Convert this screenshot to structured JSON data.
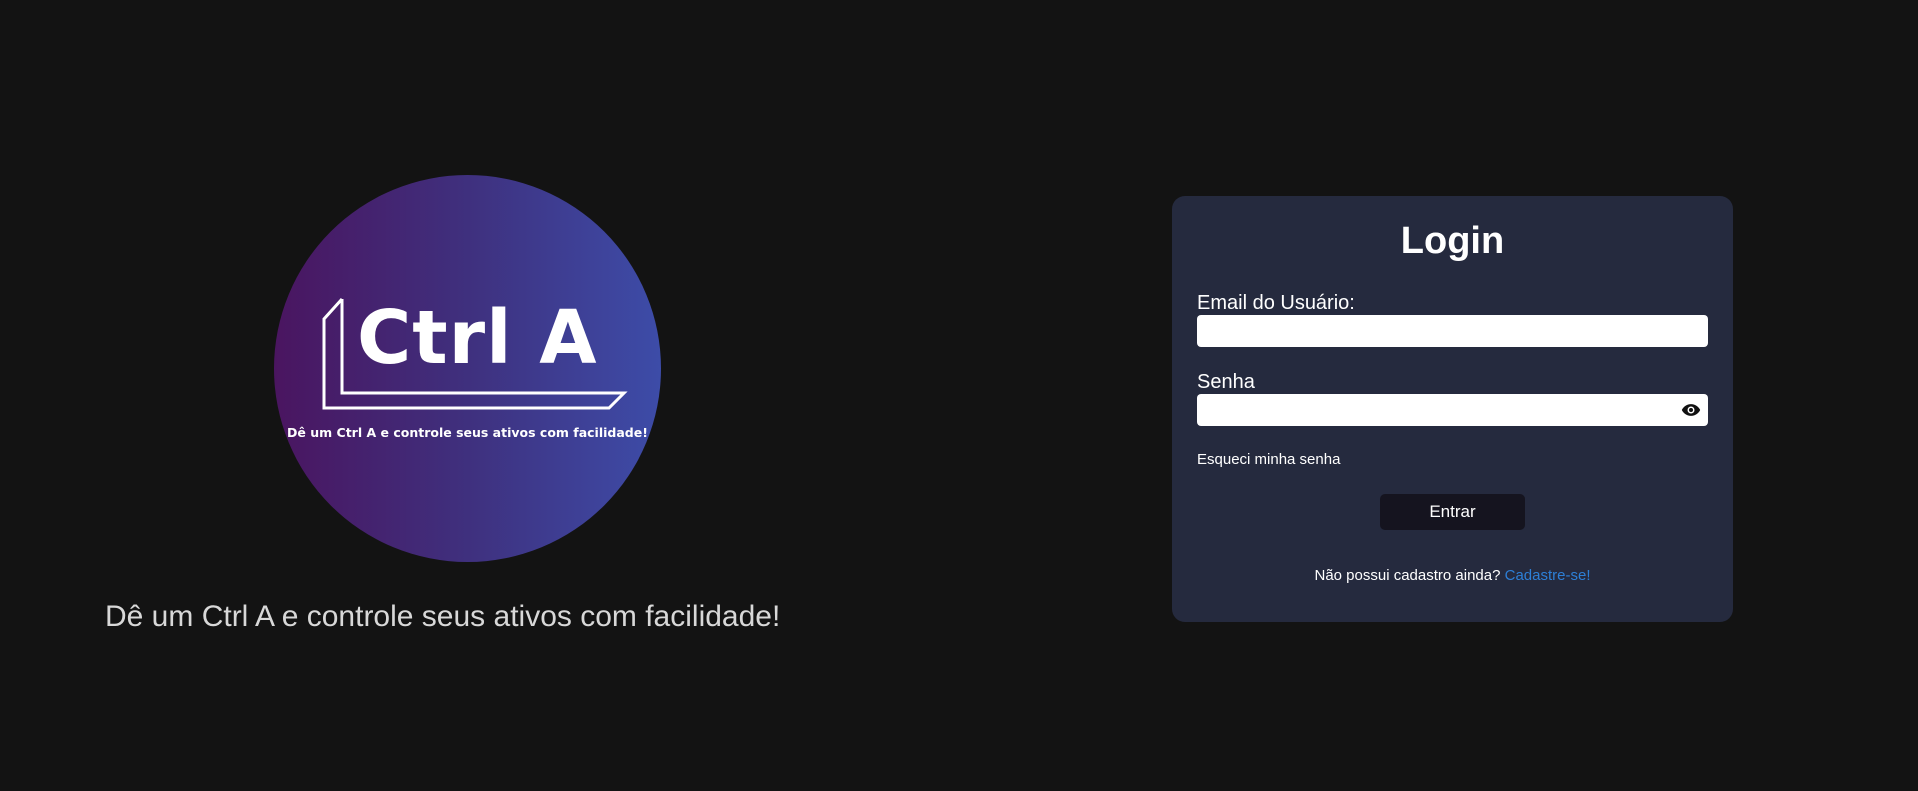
{
  "brand": {
    "logo_wordmark": "Ctrl A",
    "logo_tagline": "Dê um Ctrl A e controle seus ativos com facilidade!",
    "caption": "Dê um Ctrl A e controle seus ativos com facilidade!",
    "gradient_start": "#4a1560",
    "gradient_end": "#3d4ca8"
  },
  "login": {
    "title": "Login",
    "email_label": "Email do Usuário:",
    "email_value": "",
    "password_label": "Senha",
    "password_value": "",
    "password_toggle_icon": "eye-icon",
    "forgot_password": "Esqueci minha senha",
    "submit_label": "Entrar",
    "signup_prompt": "Não possui cadastro ainda?",
    "signup_link": "Cadastre-se!",
    "card_color": "#252a3e",
    "link_color": "#2d7fd6"
  }
}
